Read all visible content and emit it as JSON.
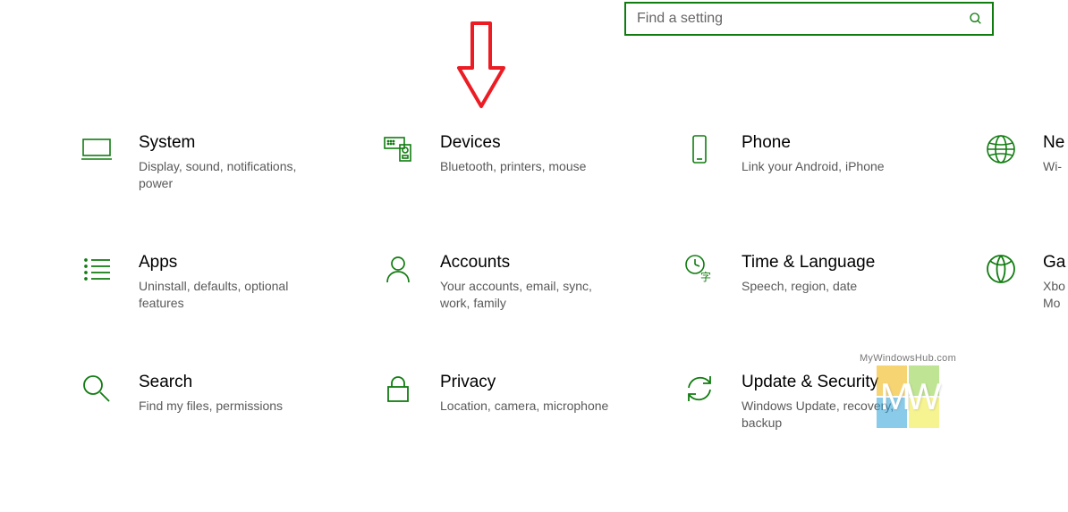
{
  "search": {
    "placeholder": "Find a setting"
  },
  "tiles": {
    "system": {
      "title": "System",
      "desc": "Display, sound, notifications, power"
    },
    "devices": {
      "title": "Devices",
      "desc": "Bluetooth, printers, mouse"
    },
    "phone": {
      "title": "Phone",
      "desc": "Link your Android, iPhone"
    },
    "network": {
      "title": "Ne",
      "desc": "Wi-"
    },
    "apps": {
      "title": "Apps",
      "desc": "Uninstall, defaults, optional features"
    },
    "accounts": {
      "title": "Accounts",
      "desc": "Your accounts, email, sync, work, family"
    },
    "timelang": {
      "title": "Time & Language",
      "desc": "Speech, region, date"
    },
    "gaming": {
      "title": "Ga",
      "desc": "Xbo\nMo"
    },
    "search": {
      "title": "Search",
      "desc": "Find my files, permissions"
    },
    "privacy": {
      "title": "Privacy",
      "desc": "Location, camera, microphone"
    },
    "update": {
      "title": "Update & Security",
      "desc": "Windows Update, recovery, backup"
    }
  },
  "watermark": {
    "text": "MyWindowsHub.com",
    "letters": "MW"
  }
}
